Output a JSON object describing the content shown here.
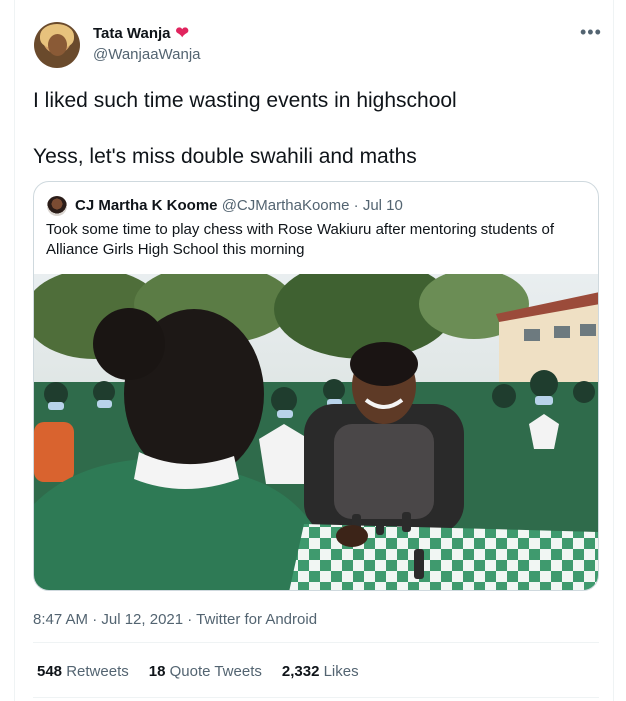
{
  "author": {
    "name": "Tata Wanja",
    "handle": "@WanjaaWanja",
    "badge_emoji": "❤"
  },
  "tweet": {
    "line1": "I liked such time wasting events in highschool",
    "line2": "Yess, let's miss double swahili and maths"
  },
  "quote": {
    "name": "CJ Martha K Koome",
    "handle": "@CJMarthaKoome",
    "separator": "·",
    "date": "Jul 10",
    "text": "Took some time to play chess with Rose Wakiuru after mentoring students of Alliance Girls High School this morning"
  },
  "meta": {
    "timestamp": "8:47 AM · Jul 12, 2021 · Twitter for Android"
  },
  "stats": {
    "retweets_count": "548",
    "retweets_label": "Retweets",
    "quotes_count": "18",
    "quotes_label": "Quote Tweets",
    "likes_count": "2,332",
    "likes_label": "Likes"
  },
  "icons": {
    "more": "more-options-icon",
    "heart": "heart-icon"
  },
  "colors": {
    "text": "#0f1419",
    "secondary": "#536471",
    "border": "#cfd9de",
    "heart": "#e0245e"
  }
}
